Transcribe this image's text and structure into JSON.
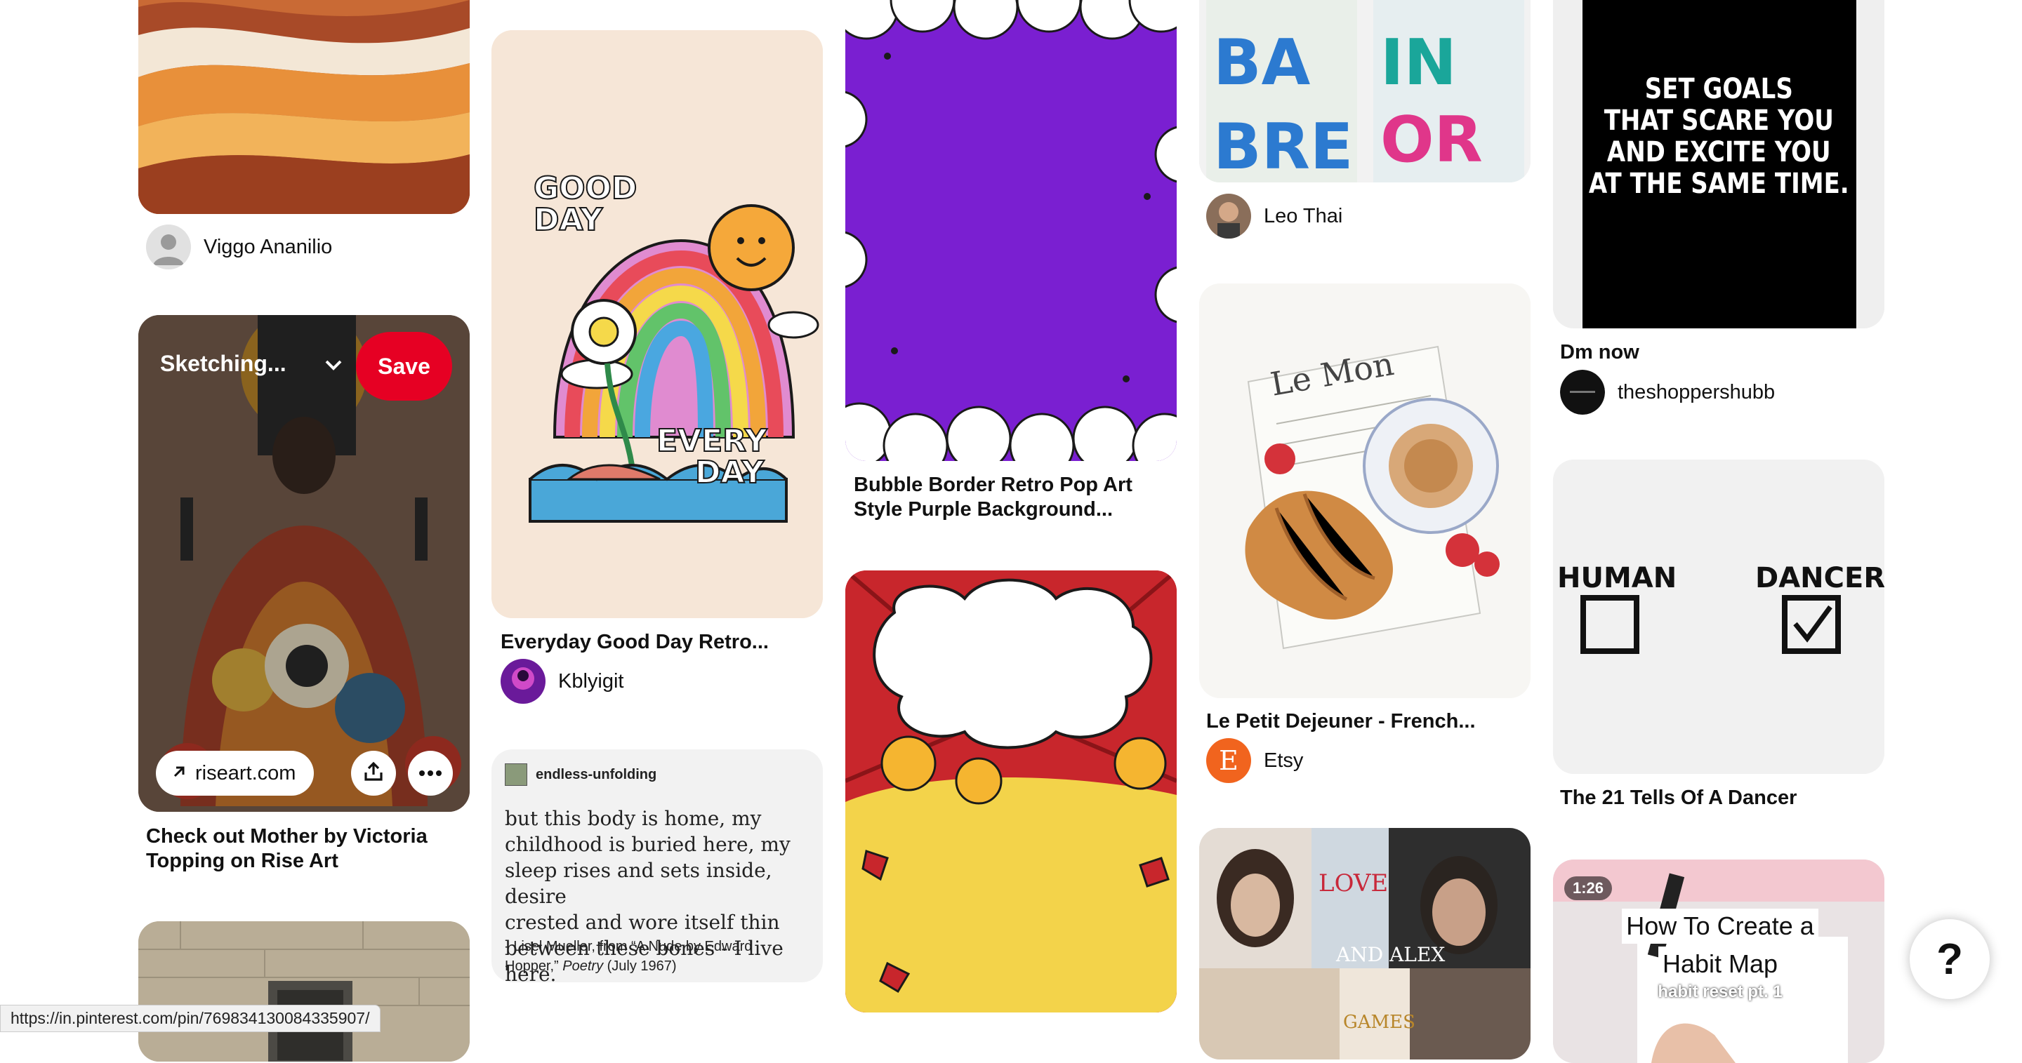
{
  "pins": [
    {
      "author": "Viggo Ananilio"
    },
    {
      "board_label": "Sketching...",
      "save_label": "Save",
      "link_label": "riseart.com",
      "title_line1": "Check out Mother by Victoria",
      "title_line2": "Topping on Rise Art"
    },
    {
      "art_text": [
        "GOOD",
        "DAY",
        "EVERY",
        "DAY"
      ],
      "title": "Everyday Good Day Retro...",
      "author": "Kblyigit"
    },
    {
      "handle": "endless-unfolding",
      "quote_lines": [
        "but this body  is home, my",
        "childhood  is buried here, my",
        "sleep  rises and sets inside,  desire",
        "crested and wore itself thin",
        "between these bones -  I live here."
      ],
      "source_line1": "- Lisel Mueller, from “A Nude by Edward",
      "source_line2a": "Hopper,” ",
      "source_italic": "Poetry",
      "source_line2b": " (July 1967)"
    },
    {
      "title_line1": "Bubble Border Retro Pop Art",
      "title_line2": "Style Purple Background..."
    },
    {
      "author": "Leo Thai"
    },
    {
      "art_text": "Le Mon",
      "title": "Le Petit Dejeuner - French...",
      "author": "Etsy",
      "avatar_letter": "E"
    },
    {
      "art_text": [
        "LOVE",
        "AND ALEX",
        "GAMES"
      ]
    },
    {
      "art_lines": [
        "SET GOALS",
        "THAT SCARE YOU",
        "AND EXCITE YOU",
        "AT THE SAME TIME."
      ],
      "title": "Dm now",
      "author": "theshoppershubb"
    },
    {
      "art_left": "HUMAN",
      "art_right": "DANCER",
      "title": "The 21 Tells Of A Dancer"
    },
    {
      "duration": "1:26",
      "art_line1": "How To Create a",
      "art_line2": "Habit Map",
      "art_line3": "habit reset pt. 1"
    }
  ],
  "status_url": "https://in.pinterest.com/pin/769834130084335907/",
  "help_label": "?",
  "colors": {
    "save": "#e60023",
    "purple_bg": "#7a1fd1",
    "etsy": "#f1641e"
  }
}
